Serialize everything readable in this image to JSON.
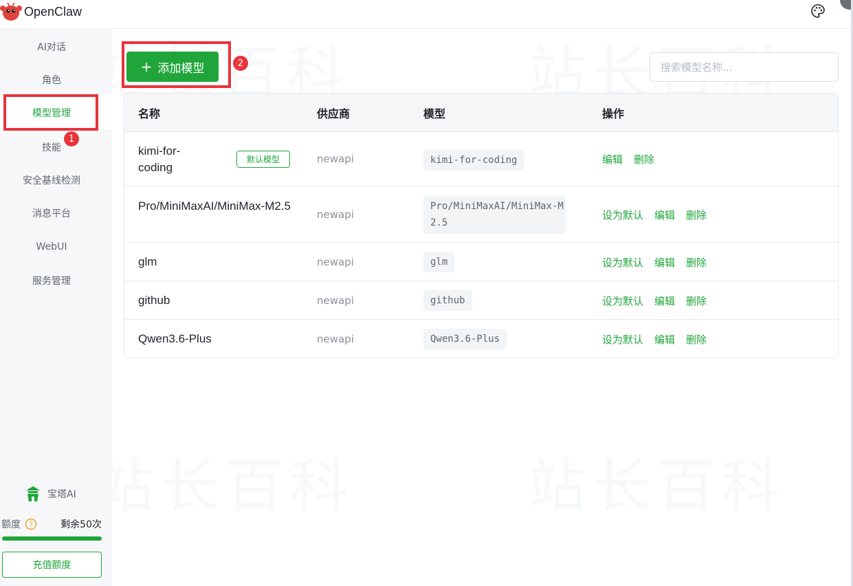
{
  "app": {
    "title": "OpenClaw"
  },
  "sidebar": {
    "items": [
      {
        "label": "AI对话"
      },
      {
        "label": "角色"
      },
      {
        "label": "模型管理"
      },
      {
        "label": "技能"
      },
      {
        "label": "安全基线检测"
      },
      {
        "label": "消息平台"
      },
      {
        "label": "WebUI"
      },
      {
        "label": "服务管理"
      }
    ],
    "active_index": 2,
    "brand": "宝塔AI",
    "quota": {
      "label": "额度",
      "remaining": "剩余50次",
      "fill_fraction": 1.0
    },
    "recharge": "充值额度"
  },
  "annotations": {
    "badge1": "1",
    "badge2": "2",
    "highlight_color": "#e8343c"
  },
  "toolbar": {
    "add_label": "添加模型",
    "search_placeholder": "搜索模型名称..."
  },
  "table": {
    "headers": [
      "名称",
      "供应商",
      "模型",
      "操作"
    ],
    "rows": [
      {
        "name": "kimi-for-coding",
        "default_tag": "默认模型",
        "provider": "newapi",
        "model": "kimi-for-coding",
        "actions": [
          "编辑",
          "删除"
        ]
      },
      {
        "name": "Pro/MiniMaxAI/MiniMax-M2.5",
        "provider": "newapi",
        "model": "Pro/MiniMaxAI/MiniMax-M2.5",
        "actions": [
          "设为默认",
          "编辑",
          "删除"
        ]
      },
      {
        "name": "glm",
        "provider": "newapi",
        "model": "glm",
        "actions": [
          "设为默认",
          "编辑",
          "删除"
        ]
      },
      {
        "name": "github",
        "provider": "newapi",
        "model": "github",
        "actions": [
          "设为默认",
          "编辑",
          "删除"
        ]
      },
      {
        "name": "Qwen3.6-Plus",
        "provider": "newapi",
        "model": "Qwen3.6-Plus",
        "actions": [
          "设为默认",
          "编辑",
          "删除"
        ]
      }
    ]
  },
  "watermark": "站长百科",
  "colors": {
    "accent": "#20a53a",
    "highlight": "#e8343c"
  },
  "icons": {
    "logo": "lobster-logo-icon",
    "theme": "palette-icon",
    "help": "question-circle-icon",
    "brand": "pagoda-icon"
  }
}
